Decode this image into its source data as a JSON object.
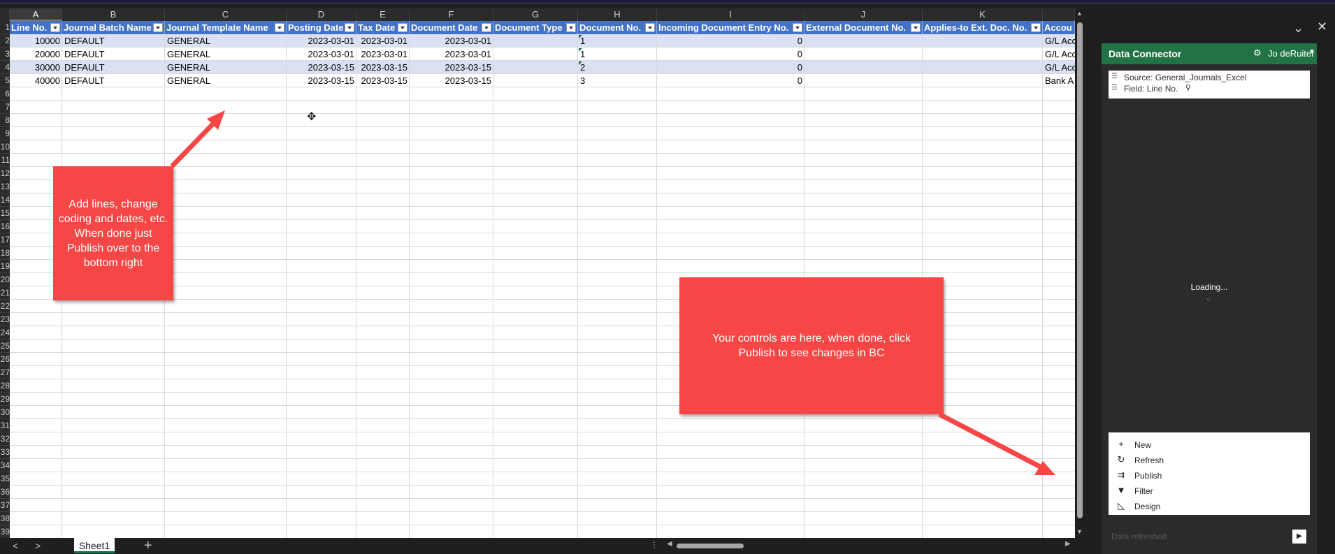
{
  "sheet": {
    "columns": [
      "A",
      "B",
      "C",
      "D",
      "E",
      "F",
      "G",
      "H",
      "I",
      "J",
      "K",
      ""
    ],
    "row_numbers": [
      "1",
      "2",
      "3",
      "4",
      "5",
      "6",
      "7",
      "8",
      "9",
      "10",
      "11",
      "12",
      "13",
      "14",
      "15",
      "16",
      "17",
      "18",
      "19",
      "20",
      "21",
      "22",
      "23",
      "24",
      "25",
      "26",
      "27",
      "28",
      "29",
      "30",
      "31",
      "32",
      "33",
      "34",
      "35",
      "36",
      "37",
      "38",
      "39"
    ],
    "table_headers": [
      "Line No.",
      "Journal Batch Name",
      "Journal Template Name",
      "Posting Date",
      "Tax Date",
      "Document Date",
      "Document Type",
      "Document No.",
      "Incoming Document Entry No.",
      "External Document No.",
      "Applies-to Ext. Doc. No.",
      "Accou"
    ],
    "rows": [
      [
        "10000",
        "DEFAULT",
        "GENERAL",
        "2023-03-01",
        "2023-03-01",
        "2023-03-01",
        "",
        "1",
        "0",
        "",
        "",
        "G/L Acc"
      ],
      [
        "20000",
        "DEFAULT",
        "GENERAL",
        "2023-03-01",
        "2023-03-01",
        "2023-03-01",
        "",
        "1",
        "0",
        "",
        "",
        "G/L Acc"
      ],
      [
        "30000",
        "DEFAULT",
        "GENERAL",
        "2023-03-15",
        "2023-03-15",
        "2023-03-15",
        "",
        "2",
        "0",
        "",
        "",
        "G/L Acc"
      ],
      [
        "40000",
        "DEFAULT",
        "GENERAL",
        "2023-03-15",
        "2023-03-15",
        "2023-03-15",
        "",
        "3",
        "0",
        "",
        "",
        "Bank A"
      ]
    ],
    "sheet_tab": "Sheet1",
    "add_sheet_label": "+",
    "nav_prev": "<",
    "nav_next": ">"
  },
  "pane": {
    "title": "Data Connector",
    "user": "Jo deRuiter",
    "source_line": "Source: General_Journals_Excel",
    "field_line": "Field: Line No.",
    "loading_text": "Loading...",
    "actions": [
      {
        "label": "New",
        "icon": "plus-icon"
      },
      {
        "label": "Refresh",
        "icon": "refresh-icon"
      },
      {
        "label": "Publish",
        "icon": "publish-icon"
      },
      {
        "label": "Filter",
        "icon": "filter-icon"
      },
      {
        "label": "Design",
        "icon": "design-icon"
      }
    ],
    "status_text": "Data refreshed"
  },
  "callouts": {
    "left": "Add lines, change coding and dates, etc.  When done just Publish over to the bottom right",
    "right": "Your controls are here, when done, click Publish to see changes in BC"
  },
  "colors": {
    "table_header": "#4472c4",
    "band": "#d9e1f2",
    "pane_header": "#217346",
    "callout": "#f64646"
  }
}
